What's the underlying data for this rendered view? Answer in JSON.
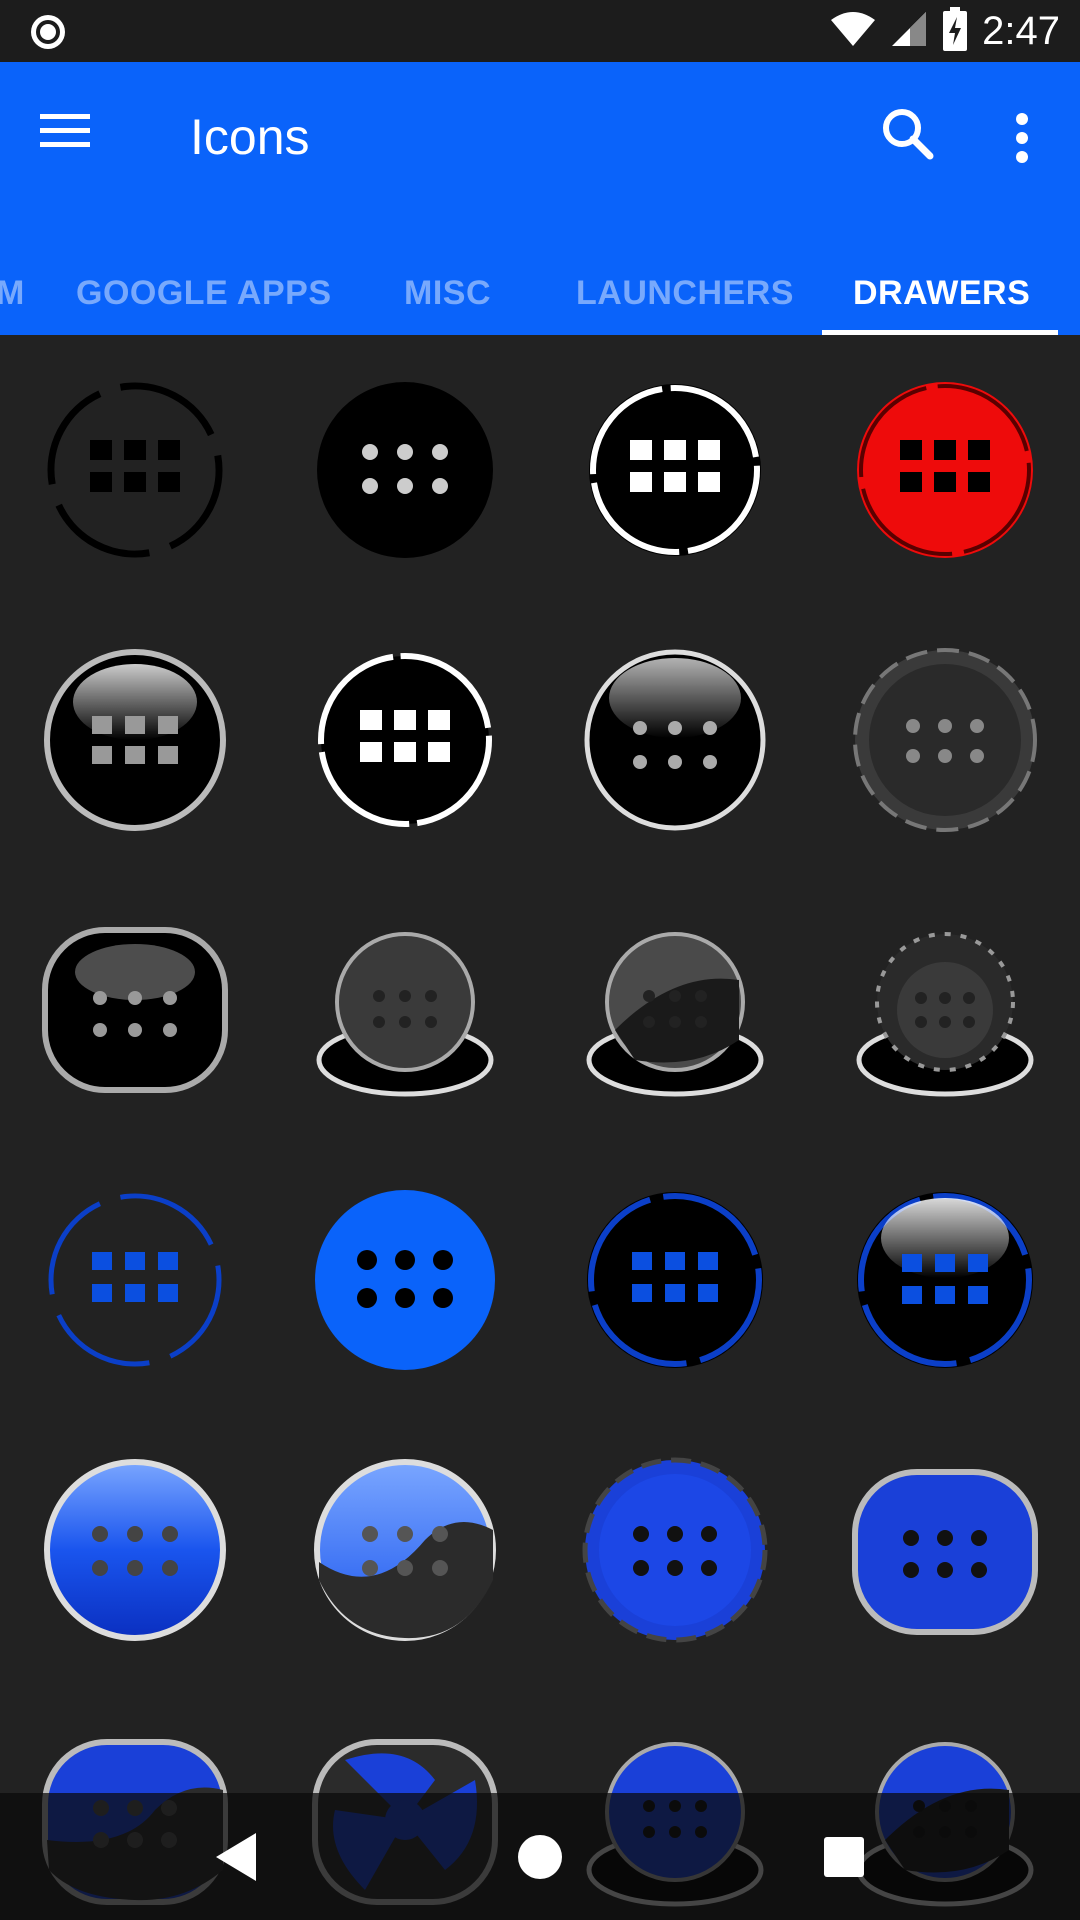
{
  "status_bar": {
    "time": "2:47",
    "left_icon": "record-icon",
    "right_icons": [
      "wifi-icon",
      "signal-icon",
      "battery-charging-icon"
    ]
  },
  "app_bar": {
    "title": "Icons",
    "menu_icon": "menu-icon",
    "search_icon": "search-icon",
    "more_icon": "more-vert-icon",
    "color": "#0a63fa"
  },
  "tabs": [
    {
      "label": "M",
      "active": false
    },
    {
      "label": "GOOGLE APPS",
      "active": false
    },
    {
      "label": "MISC",
      "active": false
    },
    {
      "label": "LAUNCHERS",
      "active": false
    },
    {
      "label": "DRAWERS",
      "active": true
    }
  ],
  "grid": {
    "icons": [
      {
        "name": "drawer-ring-black-icon"
      },
      {
        "name": "drawer-solid-black-icon"
      },
      {
        "name": "drawer-ring-white-icon"
      },
      {
        "name": "drawer-ring-red-icon"
      },
      {
        "name": "drawer-glossy-black-icon"
      },
      {
        "name": "drawer-white-outline-icon"
      },
      {
        "name": "drawer-glass-black-icon"
      },
      {
        "name": "drawer-gear-black-icon"
      },
      {
        "name": "drawer-squircle-black-icon"
      },
      {
        "name": "drawer-dome-black-icon"
      },
      {
        "name": "drawer-dome-split-icon"
      },
      {
        "name": "drawer-dome-wheel-icon"
      },
      {
        "name": "drawer-ring-blue-icon"
      },
      {
        "name": "drawer-solid-blue-icon"
      },
      {
        "name": "drawer-black-blue-ring-icon"
      },
      {
        "name": "drawer-glossy-blue-ring-icon"
      },
      {
        "name": "drawer-glossy-blue-icon"
      },
      {
        "name": "drawer-blue-wave-icon"
      },
      {
        "name": "drawer-blue-gear-icon"
      },
      {
        "name": "drawer-blue-squircle-icon"
      },
      {
        "name": "drawer-blue-split-squircle-icon"
      },
      {
        "name": "drawer-blue-fan-icon"
      },
      {
        "name": "drawer-blue-dome-icon"
      },
      {
        "name": "drawer-blue-dome-split-icon"
      }
    ]
  },
  "nav_bar": {
    "back_icon": "back-icon",
    "home_icon": "home-icon",
    "recents_icon": "recents-icon"
  },
  "colors": {
    "background": "#222222",
    "accent_blue": "#0a63fa",
    "red": "#ee0b0b"
  }
}
